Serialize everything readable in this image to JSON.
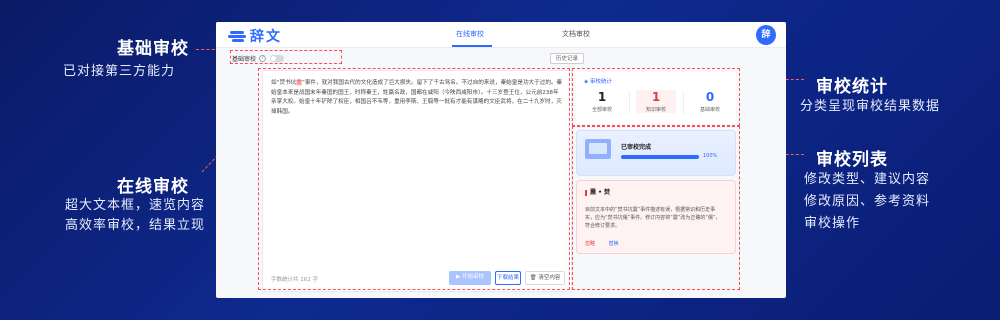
{
  "callouts": {
    "basic": {
      "title": "基础审校",
      "desc": "已对接第三方能力"
    },
    "online": {
      "title": "在线审校",
      "lines": [
        "超大文本框，速览内容",
        "高效率审校，结果立现"
      ]
    },
    "stats": {
      "title": "审校统计",
      "desc": "分类呈现审校结果数据"
    },
    "list": {
      "title": "审校列表",
      "lines": [
        "修改类型、建议内容",
        "修改原因、参考资料",
        "审校操作"
      ]
    }
  },
  "app": {
    "logo_text": "辞文",
    "tabs": [
      {
        "label": "在线审校",
        "active": true
      },
      {
        "label": "文档审校",
        "active": false
      }
    ],
    "avatar_text": "辞"
  },
  "toolbar": {
    "basic_toggle_label": "基础审校",
    "help_icon": "question-circle-icon",
    "basic_toggle_on": false,
    "history_label": "历史记录"
  },
  "editor": {
    "text_before": "如“焚书坑",
    "text_highlight": "震",
    "text_after": "”事件，就对我国古代的文化造成了巨大损失。留下了千古骂名。不过自的来说，秦始皇是功大于过的。秦始皇本来是战国末年秦国的国王，时称秦王，姓赢名政，国都在咸阳（今陕西咸阳市）。十三岁登王位，公元前238年亲掌大权。始皇十年铲除了权臣，相国吕不韦等，重用李斯、王翦等一批有才能有谋略的文臣武将，在二十九岁时，灭掉韩国。",
    "word_count": "字数统计共 162 字",
    "start_label": "开始审校",
    "next_label": "下载结果",
    "clear_label": "清空内容"
  },
  "stats": {
    "title": "审校统计",
    "items": [
      {
        "value": "1",
        "label": "全部审校",
        "color": "#222222"
      },
      {
        "value": "1",
        "label": "知识审校",
        "color": "#e23b3b"
      },
      {
        "value": "0",
        "label": "基础审校",
        "color": "#2f6bff"
      }
    ]
  },
  "progress": {
    "title": "已审校完成",
    "percent_text": "100%",
    "percent": 100
  },
  "issue": {
    "title": "震 • 焚",
    "body": "目前文本中的“焚书坑震”事件描述有误，根据常识和历史事实，应为“焚书坑儒”事件。修订内容将“震”改为正确的“儒”，符合修订要求。",
    "ignore_label": "忽略",
    "fix_label": "替换"
  },
  "colors": {
    "accent": "#2f6bff",
    "error": "#e23b3b",
    "background": "#0e2a8f"
  }
}
